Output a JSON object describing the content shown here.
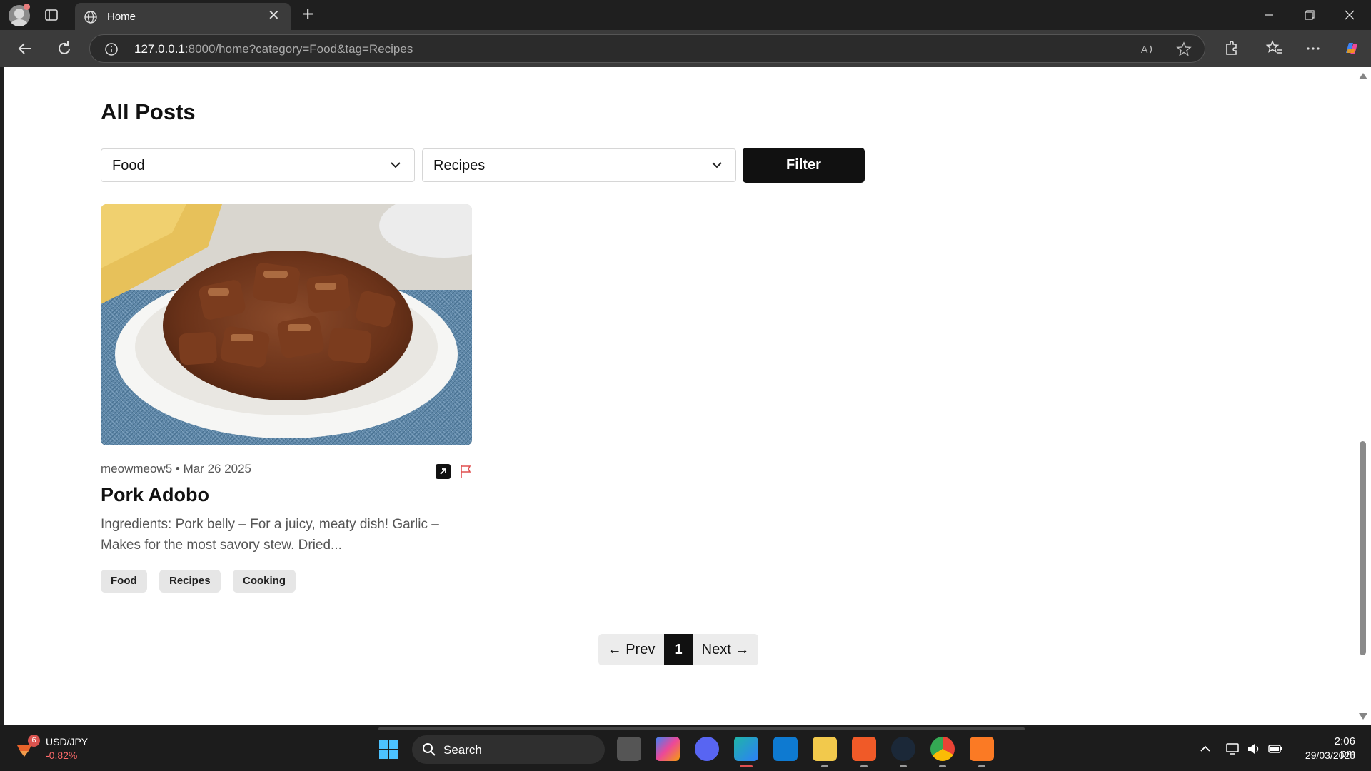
{
  "browser": {
    "tab_title": "Home",
    "url_host": "127.0.0.1",
    "url_rest": ":8000/home?category=Food&tag=Recipes"
  },
  "page": {
    "title": "All Posts",
    "category_select": {
      "value": "Food"
    },
    "tag_select": {
      "value": "Recipes"
    },
    "filter_label": "Filter"
  },
  "post": {
    "author": "meowmeow5",
    "separator": " • ",
    "date": "Mar 26 2025",
    "title": "Pork Adobo",
    "excerpt": "Ingredients: Pork belly – For a juicy, meaty dish! Garlic – Makes for the most savory stew. Dried...",
    "tags": [
      "Food",
      "Recipes",
      "Cooking"
    ],
    "image_icon": "food-photo-icon"
  },
  "pagination": {
    "prev": "← Prev",
    "current": "1",
    "next": "Next →"
  },
  "taskbar": {
    "stock_name": "USD/JPY",
    "stock_change": "-0.82%",
    "stock_badge": "6",
    "search_label": "Search",
    "time": "2:06 pm",
    "date": "29/03/2025"
  },
  "colors": {
    "accent_dark": "#111111",
    "tag_bg": "#e6e6e6",
    "flag": "#e05050",
    "stock_down": "#ff6b6b"
  }
}
